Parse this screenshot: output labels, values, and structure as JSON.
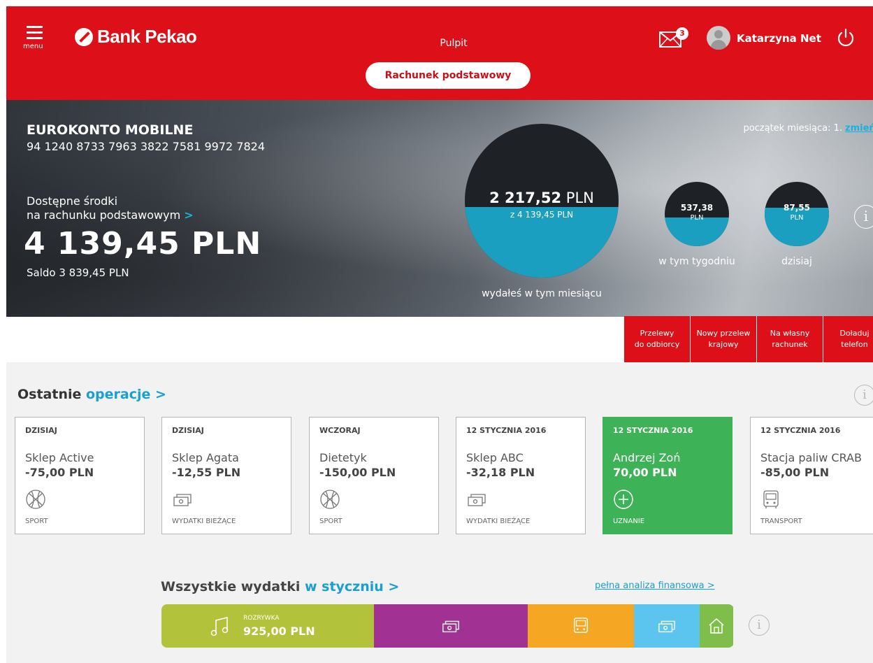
{
  "header": {
    "menu_label": "menu",
    "brand": "Bank Pekao",
    "page_title": "Pulpit",
    "account_selector": "Rachunek podstawowy",
    "mail_badge": "3",
    "user_name": "Katarzyna Net",
    "brand_color": "#dd1019"
  },
  "account": {
    "name": "EUROKONTO MOBILNE",
    "number": "94 1240 8733 7963 3822 7581 9972 7824",
    "available_line1": "Dostępne środki",
    "available_line2": "na rachunku podstawowym",
    "available_arrow": ">",
    "balance": "4 139,45 PLN",
    "saldo": "Saldo 3 839,45 PLN",
    "month_start": "początek miesiąca: 1.",
    "change_link": "zmień"
  },
  "spending": {
    "month": {
      "amount": "2 217,52",
      "unit": "PLN",
      "of_total": "z 4 139,45 PLN",
      "caption": "wydałeś w tym miesiącu",
      "fill_fraction": 0.46
    },
    "week": {
      "amount": "537,38",
      "unit": "PLN",
      "caption": "w tym tygodniu",
      "fill_fraction": 0.45
    },
    "today": {
      "amount": "87,55",
      "unit": "PLN",
      "caption": "dzisiaj",
      "fill_fraction": 0.6
    },
    "info_icon": "i",
    "circle_color": "#1a9fc0"
  },
  "quick_actions": [
    {
      "line1": "Przelewy",
      "line2": "do odbiorcy"
    },
    {
      "line1": "Nowy przelew",
      "line2": "krajowy"
    },
    {
      "line1": "Na własny",
      "line2": "rachunek"
    },
    {
      "line1": "Doładuj",
      "line2": "telefon"
    }
  ],
  "operations": {
    "title": "Ostatnie",
    "title_link": "operacje >",
    "info_icon": "i",
    "items": [
      {
        "date": "DZISIAJ",
        "name": "Sklep Active",
        "amount": "-75,00 PLN",
        "category": "SPORT",
        "icon": "ball-icon"
      },
      {
        "date": "DZISIAJ",
        "name": "Sklep Agata",
        "amount": "-12,55 PLN",
        "category": "WYDATKI BIEŻĄCE",
        "icon": "cash-icon"
      },
      {
        "date": "WCZORAJ",
        "name": "Dietetyk",
        "amount": "-150,00 PLN",
        "category": "SPORT",
        "icon": "ball-icon"
      },
      {
        "date": "12 STYCZNIA 2016",
        "name": "Sklep ABC",
        "amount": "-32,18 PLN",
        "category": "WYDATKI BIEŻĄCE",
        "icon": "cash-icon"
      },
      {
        "date": "12 STYCZNIA 2016",
        "name": "Andrzej Zoń",
        "amount": "70,00 PLN",
        "category": "UZNANIE",
        "icon": "plus-circle-icon"
      },
      {
        "date": "12 STYCZNIA 2016",
        "name": "Stacja paliw CRAB",
        "amount": "-85,00 PLN",
        "category": "TRANSPORT",
        "icon": "bus-icon"
      }
    ]
  },
  "expenses": {
    "title": "Wszystkie wydatki",
    "title_link": "w styczniu >",
    "analysis_link": "pełna analiza finansowa >",
    "info_icon": "i",
    "segments": [
      {
        "label": "ROZRYWKA",
        "value": "925,00 PLN",
        "color": "#b2c23a",
        "share": 0.371,
        "icon": "music-icon"
      },
      {
        "color": "#a23194",
        "share": 0.269,
        "icon": "cash-icon"
      },
      {
        "color": "#f5a623",
        "share": 0.186,
        "icon": "bus-icon"
      },
      {
        "color": "#5bc5ef",
        "share": 0.115,
        "icon": "cash-icon"
      },
      {
        "color": "#7fbe4a",
        "share": 0.059,
        "icon": "home-icon"
      }
    ]
  }
}
